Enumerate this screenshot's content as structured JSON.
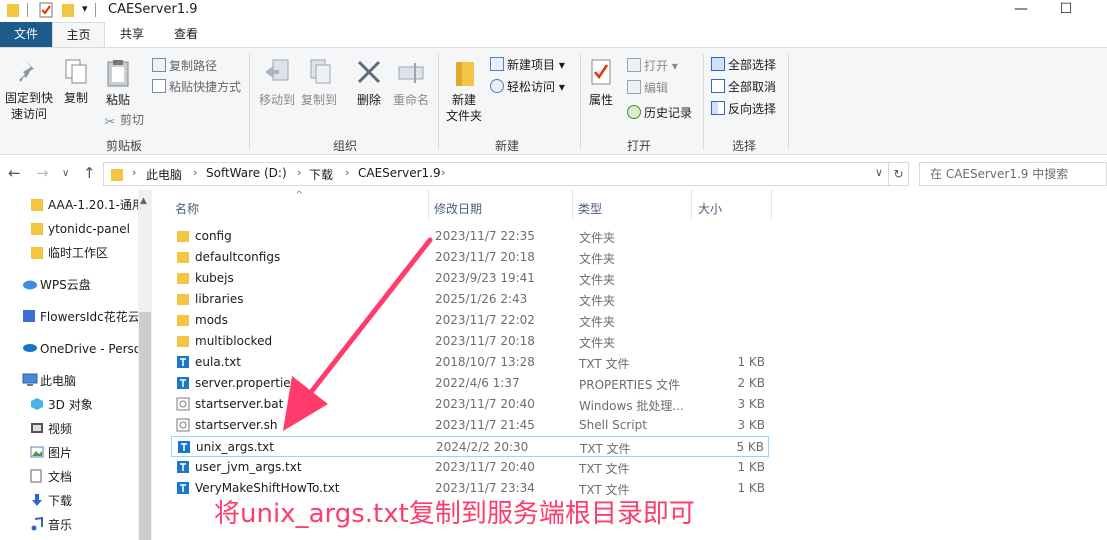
{
  "window": {
    "title": "CAEServer1.9",
    "min_glyph": "—",
    "max_glyph": "☐",
    "quick_access_down": "▾"
  },
  "ribbon_tabs": [
    "文件",
    "主页",
    "共享",
    "查看"
  ],
  "ribbon": {
    "clipboard": {
      "pin_label_1": "固定到快",
      "pin_label_2": "速访问",
      "copy_label": "复制",
      "paste_label": "粘贴",
      "copy_path": "复制路径",
      "paste_shortcut": "粘贴快捷方式",
      "cut": "剪切",
      "group": "剪贴板"
    },
    "organize": {
      "move_to": "移动到",
      "copy_to": "复制到",
      "delete": "删除",
      "rename": "重命名",
      "group": "组织"
    },
    "new": {
      "new_folder_1": "新建",
      "new_folder_2": "文件夹",
      "new_item": "新建项目",
      "easy_access": "轻松访问",
      "group": "新建"
    },
    "open": {
      "properties": "属性",
      "open": "打开",
      "edit": "编辑",
      "history": "历史记录",
      "group": "打开"
    },
    "select": {
      "select_all": "全部选择",
      "select_none": "全部取消",
      "invert": "反向选择",
      "group": "选择"
    }
  },
  "address": {
    "crumbs": [
      "此电脑",
      "SoftWare (D:)",
      "下载",
      "CAEServer1.9"
    ],
    "search_placeholder": "在 CAEServer1.9 中搜索"
  },
  "nav_pane": [
    {
      "label": "AAA-1.20.1-通用",
      "icon": "folder-icon"
    },
    {
      "label": "ytonidc-panel",
      "icon": "folder-icon"
    },
    {
      "label": "临时工作区",
      "icon": "folder-icon"
    },
    {
      "label": "WPS云盘",
      "icon": "cloud-icon"
    },
    {
      "label": "FlowersIdc花花云",
      "icon": "cube-icon"
    },
    {
      "label": "OneDrive - Perso",
      "icon": "onedrive-icon"
    },
    {
      "label": "此电脑",
      "icon": "computer-icon"
    },
    {
      "label": "3D 对象",
      "icon": "3d-objects-icon"
    },
    {
      "label": "视频",
      "icon": "video-icon"
    },
    {
      "label": "图片",
      "icon": "pictures-icon"
    },
    {
      "label": "文档",
      "icon": "documents-icon"
    },
    {
      "label": "下载",
      "icon": "download-icon"
    },
    {
      "label": "音乐",
      "icon": "music-icon"
    }
  ],
  "columns": {
    "name": "名称",
    "date": "修改日期",
    "type": "类型",
    "size": "大小"
  },
  "files": [
    {
      "name": "config",
      "date": "2023/11/7 22:35",
      "type": "文件夹",
      "size": "",
      "icon": "folder"
    },
    {
      "name": "defaultconfigs",
      "date": "2023/11/7 20:18",
      "type": "文件夹",
      "size": "",
      "icon": "folder"
    },
    {
      "name": "kubejs",
      "date": "2023/9/23 19:41",
      "type": "文件夹",
      "size": "",
      "icon": "folder"
    },
    {
      "name": "libraries",
      "date": "2025/1/26 2:43",
      "type": "文件夹",
      "size": "",
      "icon": "folder"
    },
    {
      "name": "mods",
      "date": "2023/11/7 22:02",
      "type": "文件夹",
      "size": "",
      "icon": "folder"
    },
    {
      "name": "multiblocked",
      "date": "2023/11/7 20:18",
      "type": "文件夹",
      "size": "",
      "icon": "folder"
    },
    {
      "name": "eula.txt",
      "date": "2018/10/7 13:28",
      "type": "TXT 文件",
      "size": "1 KB",
      "icon": "txt"
    },
    {
      "name": "server.properties",
      "date": "2022/4/6 1:37",
      "type": "PROPERTIES 文件",
      "size": "2 KB",
      "icon": "txt"
    },
    {
      "name": "startserver.bat",
      "date": "2023/11/7 20:40",
      "type": "Windows 批处理...",
      "size": "3 KB",
      "icon": "script"
    },
    {
      "name": "startserver.sh",
      "date": "2023/11/7 21:45",
      "type": "Shell Script",
      "size": "3 KB",
      "icon": "script"
    },
    {
      "name": "unix_args.txt",
      "date": "2024/2/2 20:30",
      "type": "TXT 文件",
      "size": "5 KB",
      "icon": "txt"
    },
    {
      "name": "user_jvm_args.txt",
      "date": "2023/11/7 20:40",
      "type": "TXT 文件",
      "size": "1 KB",
      "icon": "txt"
    },
    {
      "name": "VeryMakeShiftHowTo.txt",
      "date": "2023/11/7 23:34",
      "type": "TXT 文件",
      "size": "1 KB",
      "icon": "txt"
    }
  ],
  "highlighted_file": "unix_args.txt",
  "annotation": "将unix_args.txt复制到服务端根目录即可",
  "colors": {
    "accent": "#1e5a8a",
    "annotation": "#ff3c6b",
    "folder": "#f4c542",
    "selection_border": "#99d1ff"
  }
}
